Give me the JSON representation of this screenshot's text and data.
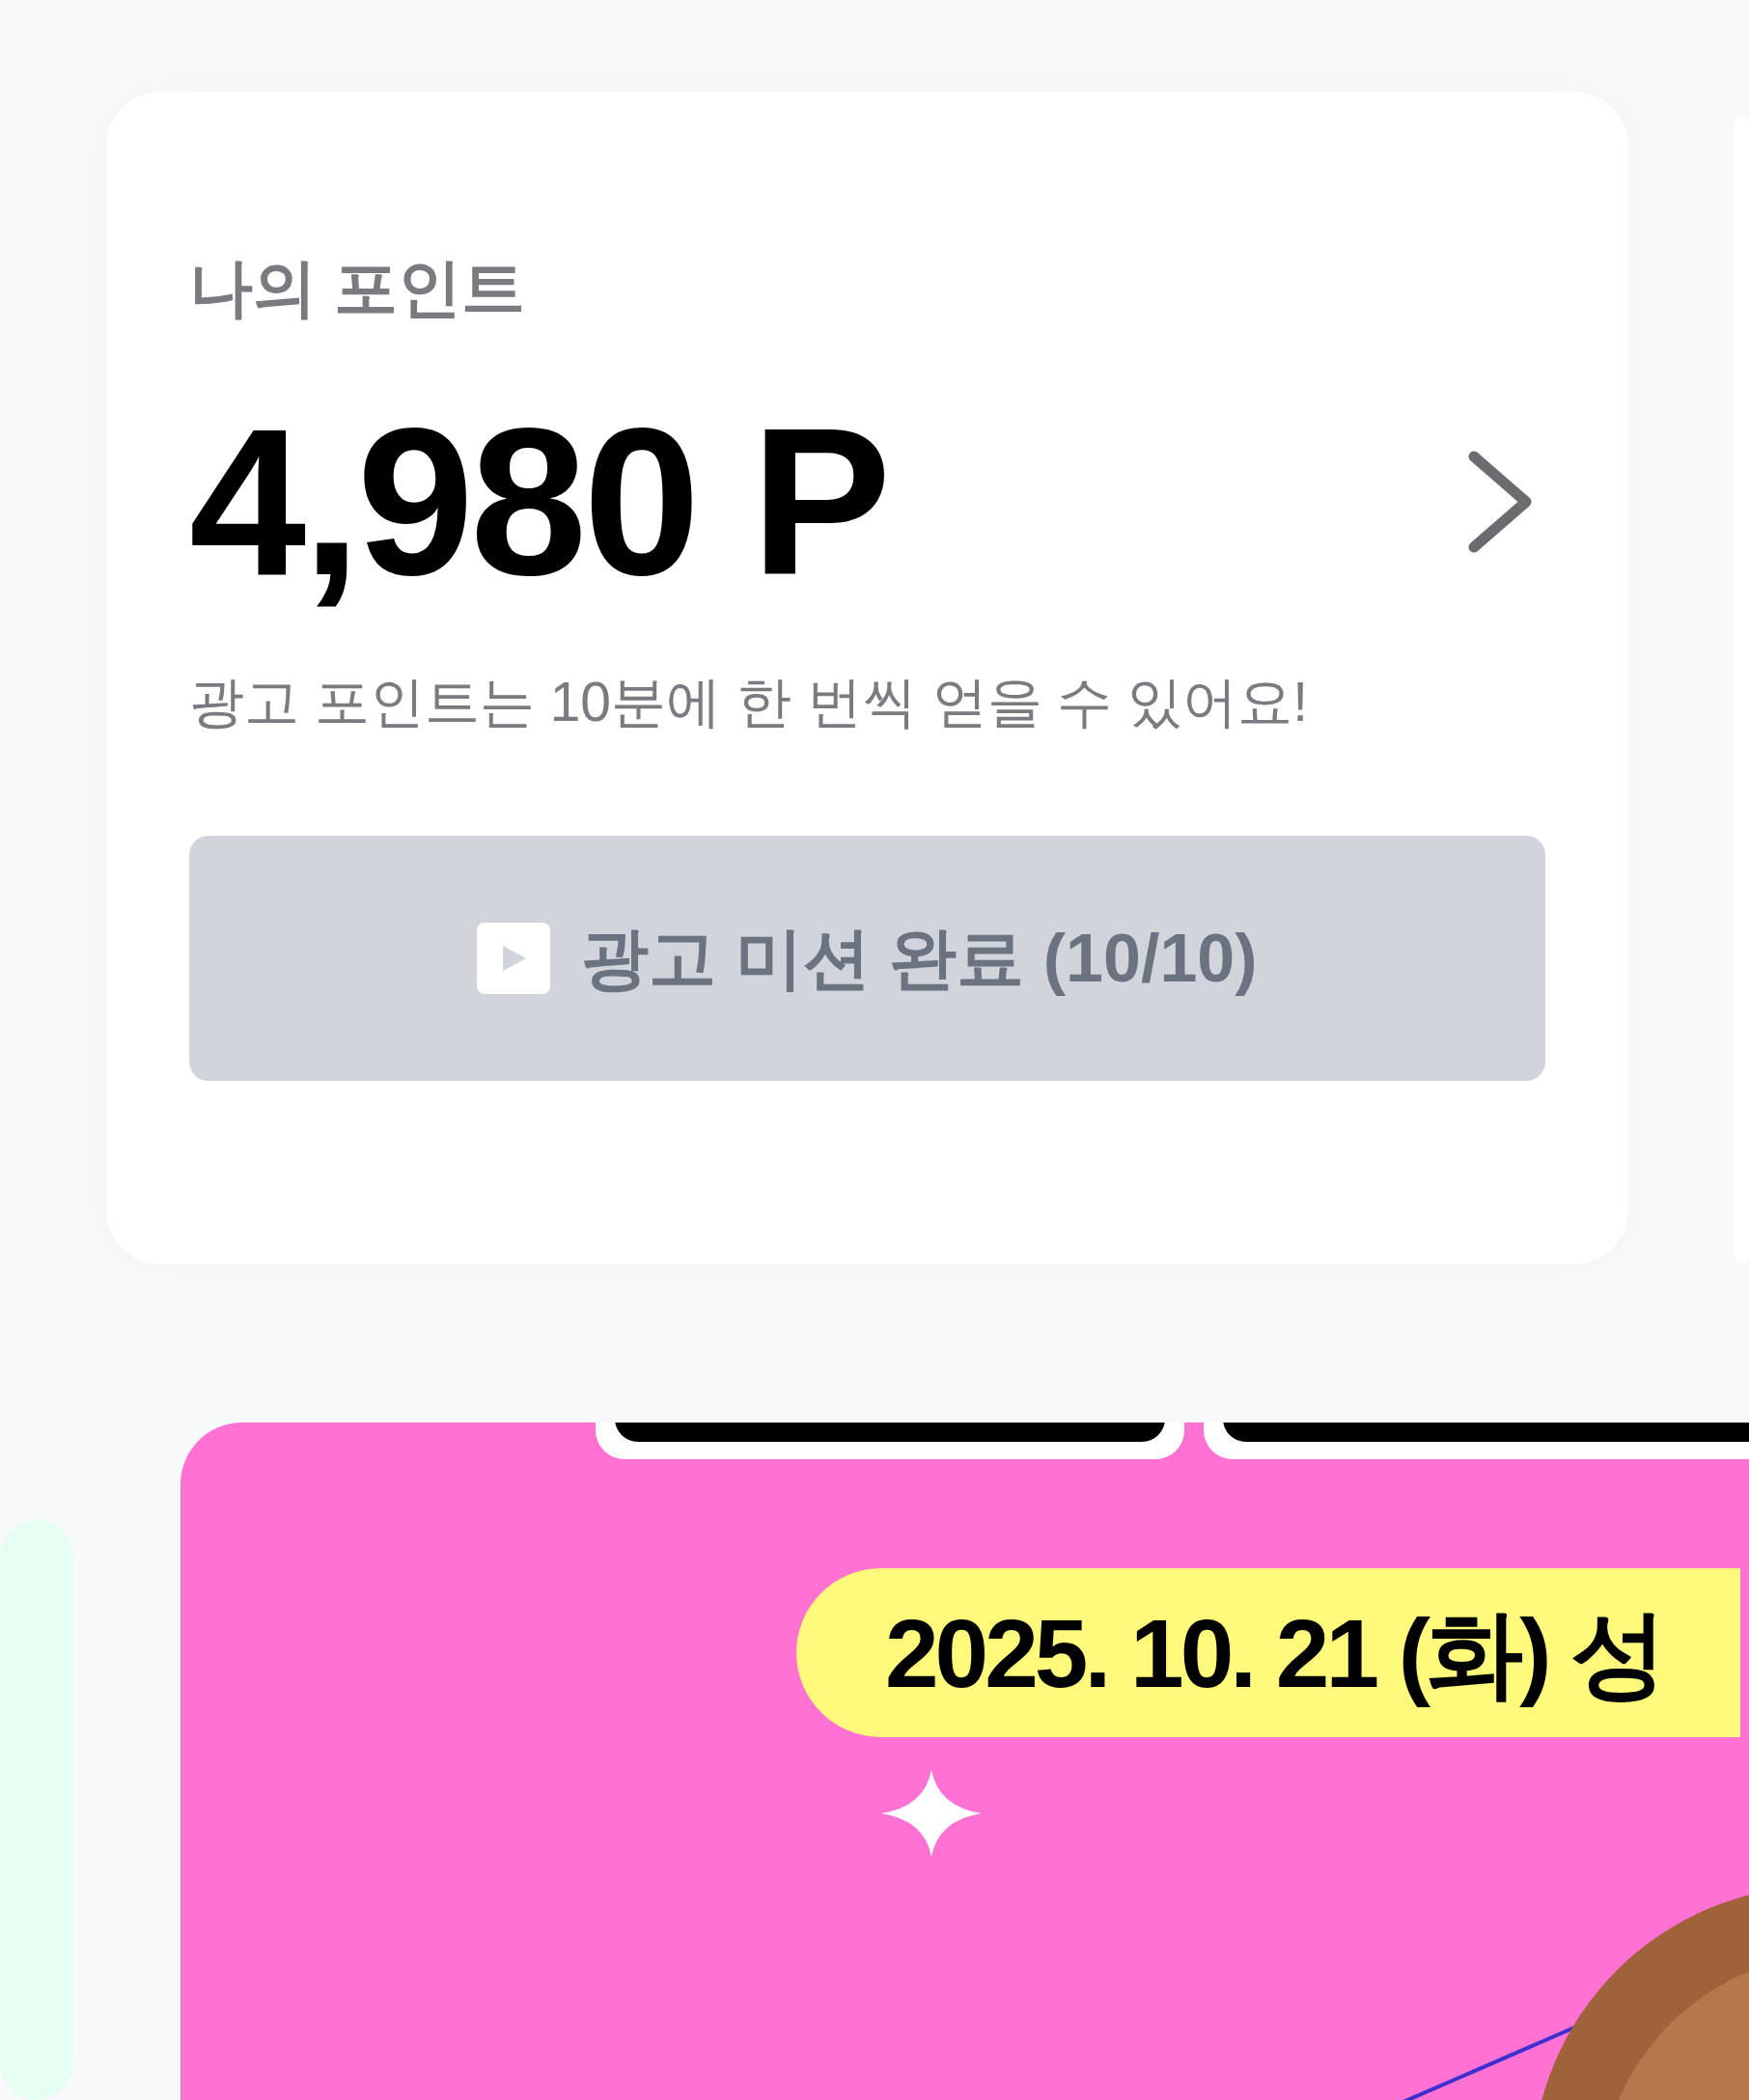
{
  "points_card": {
    "title": "나의 포인트",
    "amount": "4,980 P",
    "note": "광고 포인트는 10분에 한 번씩 얻을 수 있어요!",
    "mission_button": {
      "label": "광고 미션 완료 (10/10)",
      "disabled": true
    }
  },
  "banner": {
    "date_tag": "2025. 10. 21 (화) 성"
  }
}
